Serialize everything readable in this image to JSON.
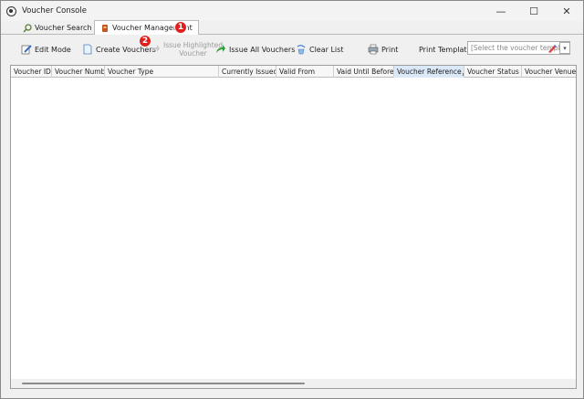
{
  "window": {
    "title": "Voucher Console",
    "controls": {
      "minimize": "—",
      "maximize": "☐",
      "close": "✕"
    }
  },
  "tabs": [
    {
      "label": "Voucher Search",
      "icon": "magnifier-icon"
    },
    {
      "label": "Voucher Management",
      "icon": "voucher-management-icon",
      "active": true
    }
  ],
  "badges": {
    "one": "1",
    "two": "2",
    "color": "#e0201c"
  },
  "toolbar": {
    "edit_mode": "Edit Mode",
    "create_vouchers": "Create Vouchers",
    "issue_highlighted_line1": "Issue Highlighted",
    "issue_highlighted_line2": "Voucher",
    "issue_all": "Issue All Vouchers",
    "clear_list": "Clear List",
    "print": "Print",
    "print_template": "Print Template",
    "template_placeholder": "[Select the voucher templa"
  },
  "grid": {
    "columns": [
      "Voucher ID",
      "Voucher Number",
      "Voucher Type",
      "Currently Issued",
      "Valid From",
      "Vaid Until Before",
      "Voucher Reference",
      "Voucher Status",
      "Voucher Venue"
    ]
  }
}
